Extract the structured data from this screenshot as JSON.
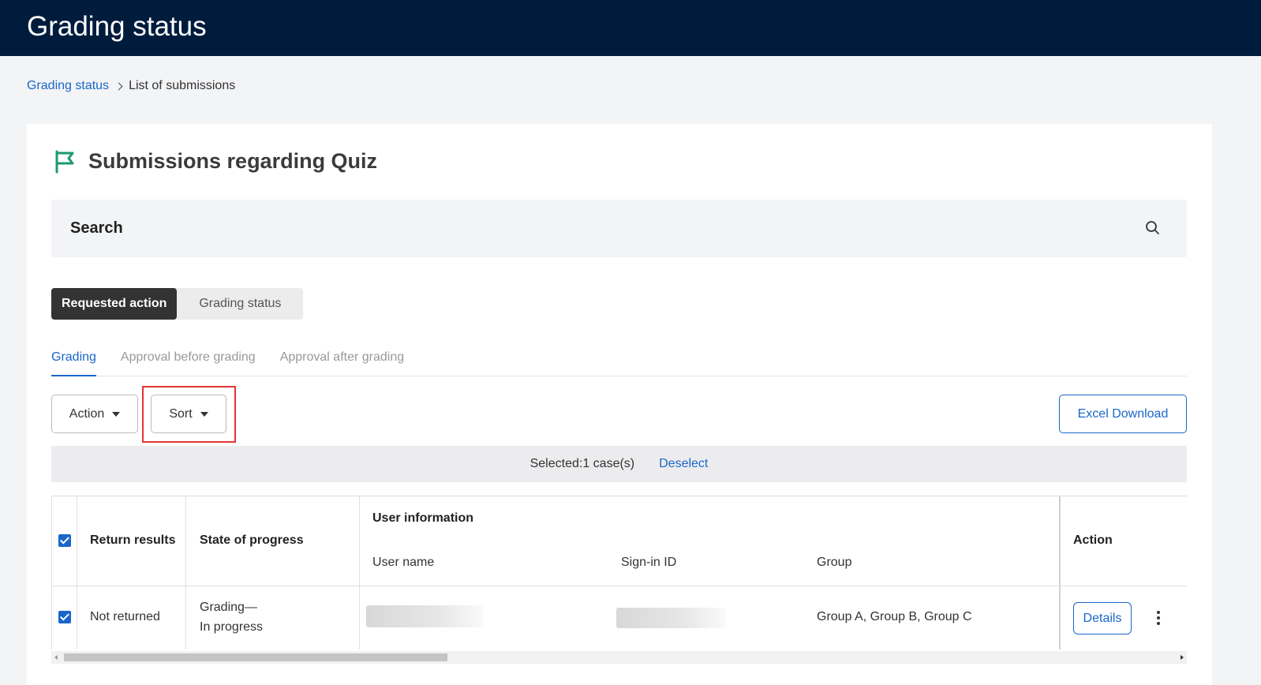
{
  "header": {
    "title": "Grading status"
  },
  "breadcrumb": {
    "link": "Grading status",
    "current": "List of submissions"
  },
  "page": {
    "title": "Submissions regarding Quiz"
  },
  "search": {
    "label": "Search"
  },
  "segment": {
    "active": "Requested action",
    "inactive": "Grading status"
  },
  "tabs": [
    {
      "label": "Grading",
      "active": true
    },
    {
      "label": "Approval before grading",
      "active": false
    },
    {
      "label": "Approval after grading",
      "active": false
    }
  ],
  "toolbar": {
    "action_label": "Action",
    "sort_label": "Sort",
    "excel_label": "Excel Download"
  },
  "selection": {
    "count_text": "Selected:1 case(s)",
    "deselect_label": "Deselect"
  },
  "table": {
    "headers": {
      "return_results": "Return results",
      "state_of_progress": "State of progress",
      "user_information": "User information",
      "user_name": "User name",
      "sign_in_id": "Sign-in ID",
      "group": "Group",
      "action": "Action"
    },
    "rows": [
      {
        "checked": true,
        "return_results": "Not returned",
        "state_line1": "Grading—",
        "state_line2": "In progress",
        "user_name": "",
        "sign_in_id": "",
        "group": "Group A, Group B, Group C",
        "details_label": "Details"
      }
    ]
  },
  "colors": {
    "header_bg": "#001c3d",
    "accent": "#1a66c9",
    "highlight": "#e53535",
    "flag": "#1e9a6b"
  },
  "icons": [
    "flag-icon",
    "search-icon",
    "chevron-right-icon",
    "caret-down-icon",
    "check-icon",
    "kebab-icon"
  ]
}
